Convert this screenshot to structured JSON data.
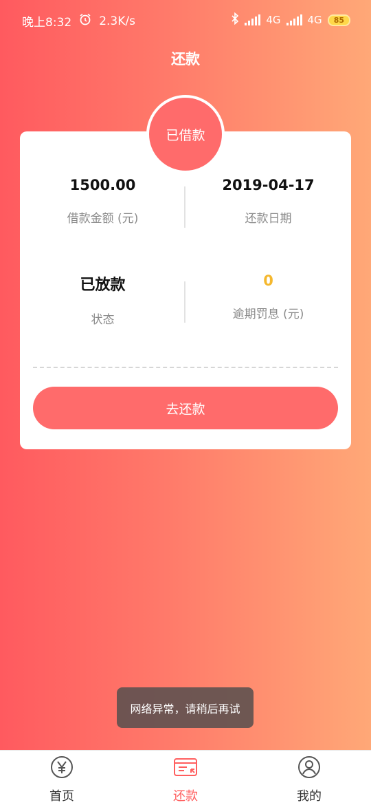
{
  "status_bar": {
    "time": "晚上8:32",
    "speed": "2.3K/s",
    "network1": "4G",
    "network2": "4G",
    "battery": "85"
  },
  "header": {
    "title": "还款"
  },
  "card": {
    "badge": "已借款",
    "amount_value": "1500.00",
    "amount_label": "借款金额 (元)",
    "date_value": "2019-04-17",
    "date_label": "还款日期",
    "status_value": "已放款",
    "status_label": "状态",
    "penalty_value": "0",
    "penalty_label": "逾期罚息 (元)",
    "repay_button": "去还款",
    "penalty_color": "#f5b82e"
  },
  "toast": {
    "message": "网络异常，请稍后再试"
  },
  "tabbar": {
    "items": [
      {
        "label": "首页",
        "icon": "yen-circle-icon"
      },
      {
        "label": "还款",
        "icon": "repay-card-icon",
        "active": true
      },
      {
        "label": "我的",
        "icon": "user-profile-icon"
      }
    ],
    "active_color": "#ff5e5e"
  }
}
